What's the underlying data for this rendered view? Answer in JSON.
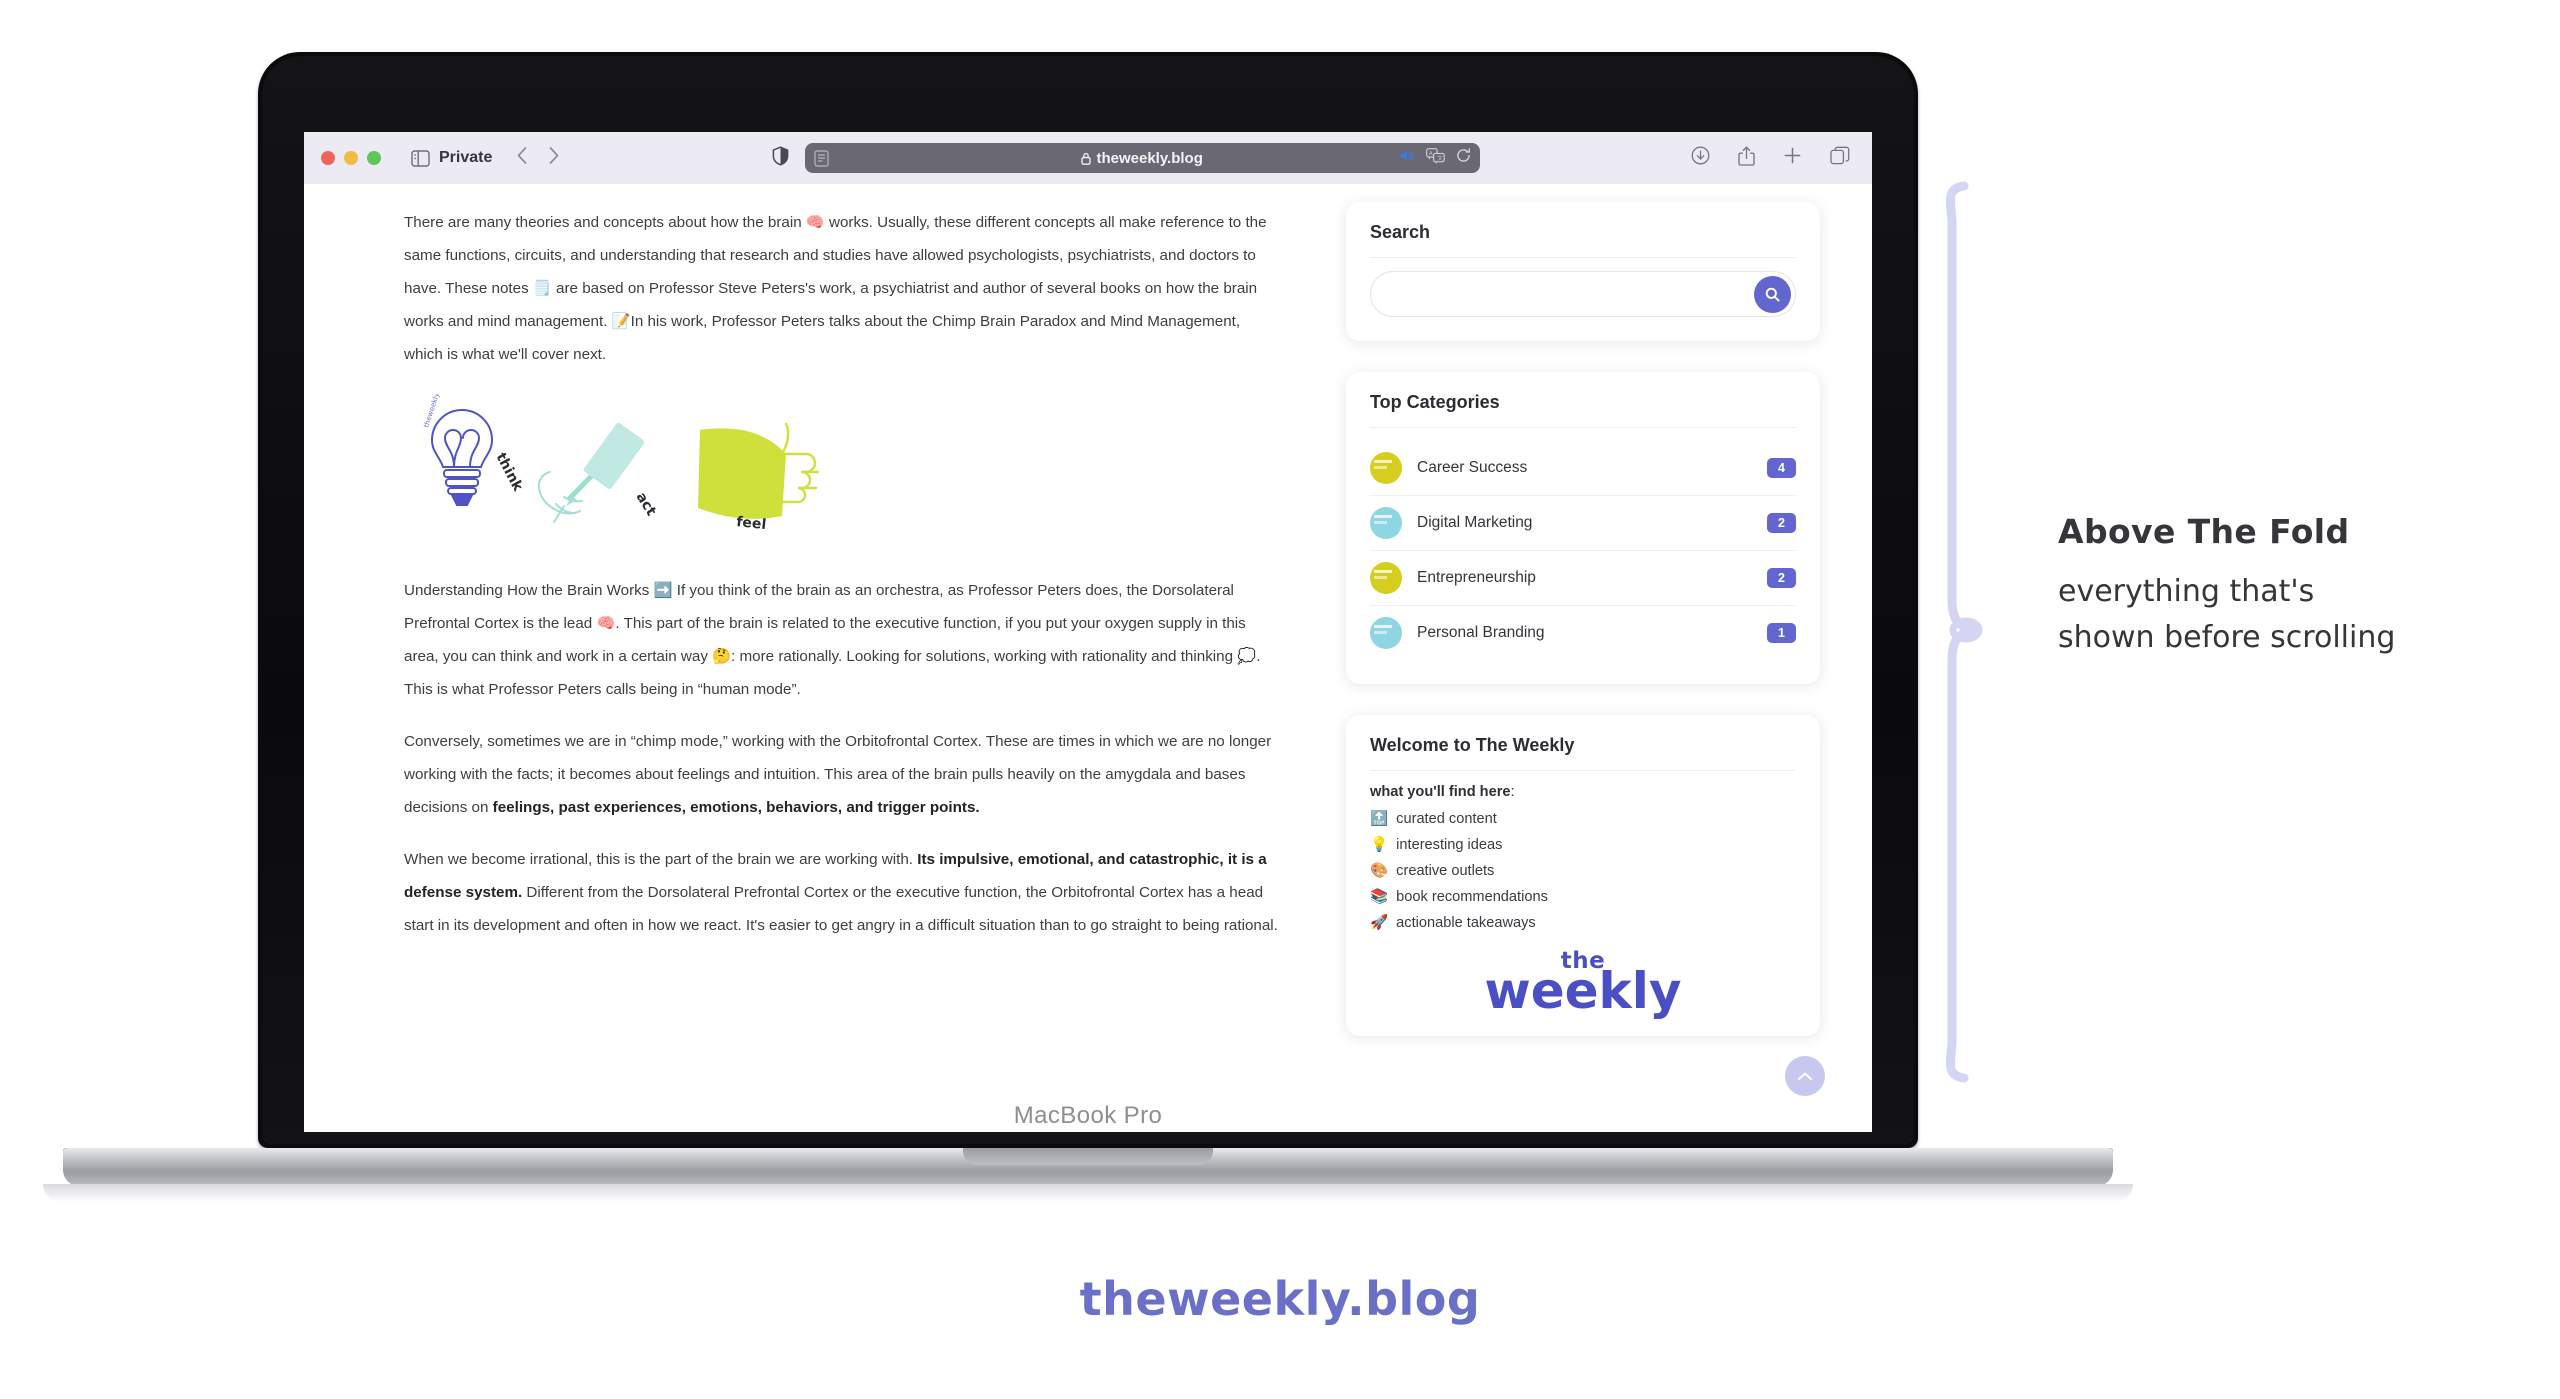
{
  "browser": {
    "window_mode_label": "Private",
    "url": "theweekly.blog",
    "lock_icon": "lock-icon",
    "reader_icon": "reader-view-icon",
    "sidebar_icon": "sidebar-toggle-icon",
    "back_icon": "back-arrow-icon",
    "forward_icon": "forward-arrow-icon",
    "shield_icon": "privacy-shield-icon",
    "audio_icon": "audio-playing-icon",
    "translate_icon": "translate-icon",
    "reload_icon": "reload-icon",
    "downloads_icon": "downloads-icon",
    "share_icon": "share-icon",
    "new_tab_icon": "new-tab-icon",
    "tab_overview_icon": "tab-overview-icon"
  },
  "article": {
    "paragraphs": [
      {
        "id": "p1",
        "runs": [
          {
            "text": "There are many theories and concepts about how the brain ",
            "bold": false
          },
          {
            "text": "🧠",
            "bold": false
          },
          {
            "text": " works. Usually, these different concepts all make reference to the same functions, circuits, and understanding that research and studies have allowed psychologists, psychiatrists, and doctors to have. These notes ",
            "bold": false
          },
          {
            "text": "🗒️",
            "bold": false
          },
          {
            "text": " are based on Professor Steve Peters's work, a psychiatrist and author of several books on how the brain works and mind management. ",
            "bold": false
          },
          {
            "text": "📝",
            "bold": false
          },
          {
            "text": "In his work, Professor Peters talks about the Chimp Brain Paradox and Mind Management, which is what we'll cover next.",
            "bold": false
          }
        ]
      },
      {
        "id": "p2",
        "runs": [
          {
            "text": "Understanding How the Brain Works ",
            "bold": false
          },
          {
            "text": "➡️",
            "bold": false
          },
          {
            "text": " If you think of the brain as an orchestra, as Professor Peters does, the Dorsolateral Prefrontal Cortex is the lead ",
            "bold": false
          },
          {
            "text": "🧠",
            "bold": false
          },
          {
            "text": ". This part of the brain is related to the executive function, if you put your oxygen supply in this area, you can think and work in a certain way ",
            "bold": false
          },
          {
            "text": "🤔",
            "bold": false
          },
          {
            "text": ": more rationally. Looking for solutions, working with rationality and thinking ",
            "bold": false
          },
          {
            "text": "💭",
            "bold": false
          },
          {
            "text": ". This is what Professor Peters calls being in “human mode”.",
            "bold": false
          }
        ]
      },
      {
        "id": "p3",
        "runs": [
          {
            "text": "Conversely, sometimes we are in “chimp mode,” working with the Orbitofrontal Cortex. These are times in which we are no longer working with the facts; it becomes about feelings and intuition. This area of the brain pulls heavily on the amygdala and bases decisions on ",
            "bold": false
          },
          {
            "text": "feelings, past experiences, emotions, behaviors, and trigger points.",
            "bold": true
          }
        ]
      },
      {
        "id": "p4",
        "runs": [
          {
            "text": "When we become irrational, this is the part of the brain we are working with. ",
            "bold": false
          },
          {
            "text": "Its impulsive, emotional, and catastrophic, it is a defense system.",
            "bold": true
          },
          {
            "text": " Different from the Dorsolateral Prefrontal Cortex or the executive function, the Orbitofrontal Cortex has a head start in its development and often in how we react. It's easier to get angry in a difficult situation than to go straight to being rational.",
            "bold": false
          }
        ]
      }
    ],
    "illustration": {
      "name": "think-act-feel-illustration",
      "labels": [
        "think",
        "act",
        "feel"
      ],
      "watermark": "theweekly.blog",
      "colors": {
        "think": "#4f53c4",
        "act": "#b6e8e0",
        "feel": "#cfe03a"
      }
    }
  },
  "sidebar": {
    "search": {
      "title": "Search",
      "value": "",
      "placeholder": "",
      "button_icon": "search-icon",
      "button_color": "#6366cf"
    },
    "categories": {
      "title": "Top Categories",
      "items": [
        {
          "label": "Career Success",
          "count": "4",
          "thumb_color": "#d6ce1e"
        },
        {
          "label": "Digital Marketing",
          "count": "2",
          "thumb_color": "#8ed6e3"
        },
        {
          "label": "Entrepreneurship",
          "count": "2",
          "thumb_color": "#d6ce1e"
        },
        {
          "label": "Personal Branding",
          "count": "1",
          "thumb_color": "#8ed6e3"
        }
      ]
    },
    "welcome": {
      "title": "Welcome to The Weekly",
      "lead_bold": "what you'll find here",
      "lead_rest": ":",
      "items": [
        {
          "emoji": "🔝",
          "label": "curated content"
        },
        {
          "emoji": "💡",
          "label": "interesting ideas"
        },
        {
          "emoji": "🎨",
          "label": "creative outlets"
        },
        {
          "emoji": "📚",
          "label": "book recommendations"
        },
        {
          "emoji": "🚀",
          "label": "actionable takeaways"
        }
      ],
      "logo_line1": "the",
      "logo_line2": "weekly"
    },
    "scroll_top_icon": "chevron-up-icon"
  },
  "device": {
    "label": "MacBook Pro"
  },
  "annotation": {
    "title": "Above The Fold",
    "line1": "everything that's",
    "line2": "shown before scrolling",
    "brace_color": "#d3d5f2"
  },
  "footer": {
    "brand": "theweekly.blog",
    "brand_color": "#6a6fc8"
  }
}
